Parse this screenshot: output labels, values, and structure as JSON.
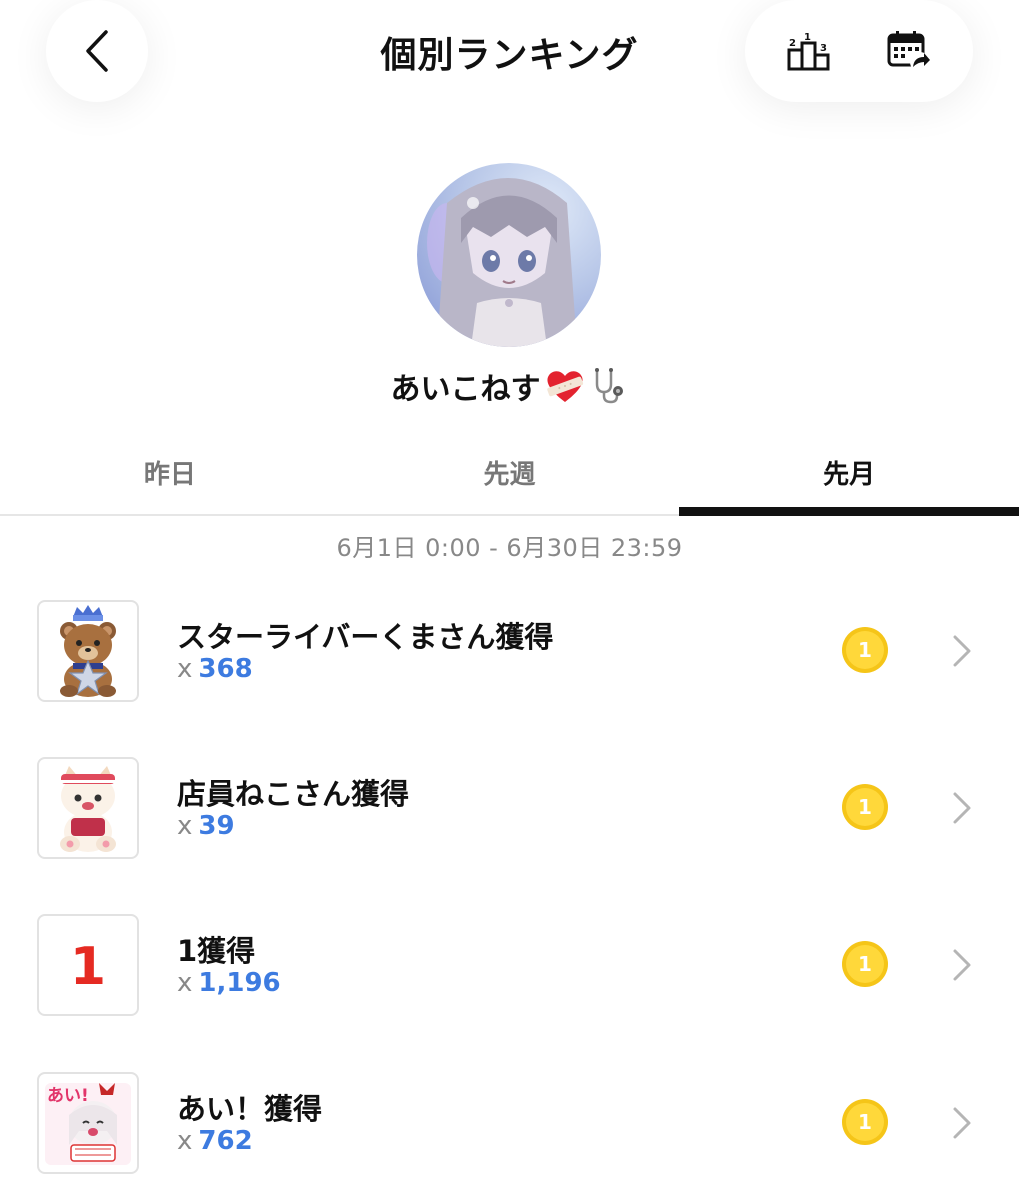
{
  "header": {
    "title": "個別ランキング",
    "back_icon": "chevron-left-icon",
    "icons": [
      "podium-ranking-icon",
      "calendar-share-icon"
    ]
  },
  "profile": {
    "name": "あいこねす",
    "emojis": [
      "bandaged-heart-icon",
      "stethoscope-icon"
    ]
  },
  "tabs": [
    {
      "label": "昨日",
      "active": false
    },
    {
      "label": "先週",
      "active": false
    },
    {
      "label": "先月",
      "active": true
    }
  ],
  "date_range": "6月1日 0:00 - 6月30日 23:59",
  "items": [
    {
      "title": "スターライバーくまさん獲得",
      "prefix": "x",
      "count": "368",
      "rank": "1",
      "thumb": "crowned-bear-icon"
    },
    {
      "title": "店員ねこさん獲得",
      "prefix": "x",
      "count": "39",
      "rank": "1",
      "thumb": "clerk-cat-icon"
    },
    {
      "title": "1獲得",
      "prefix": "x",
      "count": "1,196",
      "rank": "1",
      "thumb": "number-one-icon",
      "thumb_text": "1"
    },
    {
      "title": "あい！獲得",
      "prefix": "x",
      "count": "762",
      "rank": "1",
      "thumb": "ai-girl-sticker-icon",
      "thumb_text": "あい!"
    }
  ],
  "colors": {
    "count_blue": "#3d7be0",
    "coin_gold": "#f5c518",
    "tab_active": "#111111",
    "muted_text": "#888888"
  }
}
